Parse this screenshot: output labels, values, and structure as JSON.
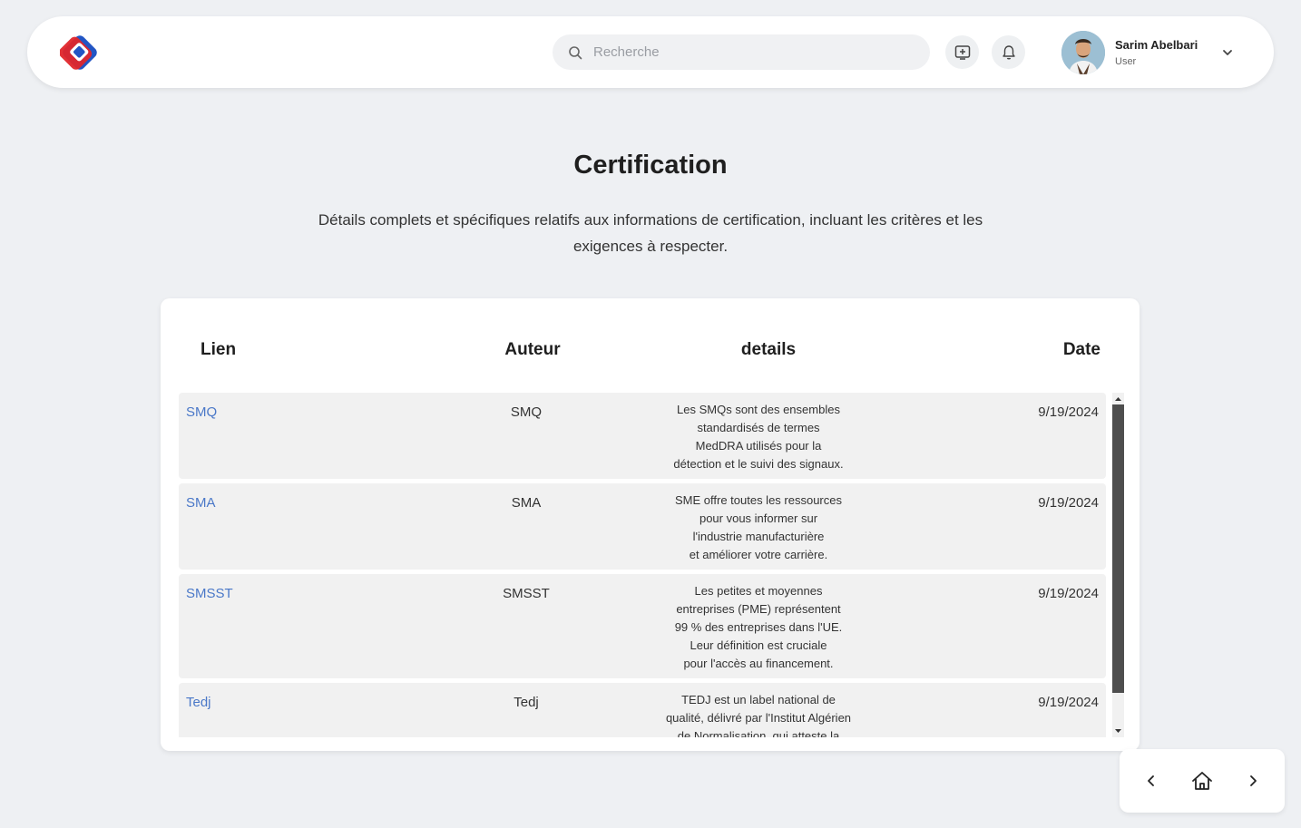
{
  "header": {
    "logo": "app-logo",
    "search": {
      "placeholder": "Recherche",
      "value": ""
    },
    "user": {
      "name": "Sarim Abelbari",
      "role": "User"
    }
  },
  "page": {
    "title": "Certification",
    "description": "Détails complets et spécifiques relatifs aux informations de certification, incluant les critères et les exigences à respecter."
  },
  "table": {
    "columns": {
      "lien": "Lien",
      "auteur": "Auteur",
      "details": "details",
      "date": "Date"
    },
    "rows": [
      {
        "lien": "SMQ",
        "auteur": "SMQ",
        "date": "9/19/2024",
        "details": [
          "Les SMQs sont des ensembles",
          "standardisés de termes",
          "MedDRA utilisés pour la",
          "détection et le suivi des signaux."
        ]
      },
      {
        "lien": "SMA",
        "auteur": "SMA",
        "date": "9/19/2024",
        "details": [
          "SME offre toutes les ressources",
          "pour vous informer sur",
          "l'industrie manufacturière",
          "et améliorer votre carrière."
        ]
      },
      {
        "lien": "SMSST",
        "auteur": "SMSST",
        "date": "9/19/2024",
        "details": [
          "Les petites et moyennes",
          "entreprises (PME) représentent",
          "99 % des entreprises dans l'UE.",
          "Leur définition est cruciale",
          "pour l'accès au financement."
        ]
      },
      {
        "lien": "Tedj",
        "auteur": "Tedj",
        "date": "9/19/2024",
        "details": [
          "TEDJ est un label national de",
          "qualité, délivré par l'Institut Algérien",
          "de Normalisation, qui atteste la"
        ]
      }
    ]
  },
  "colors": {
    "accent_link": "#4a78c8",
    "logo_red": "#e0262b",
    "logo_blue": "#2255c4"
  }
}
